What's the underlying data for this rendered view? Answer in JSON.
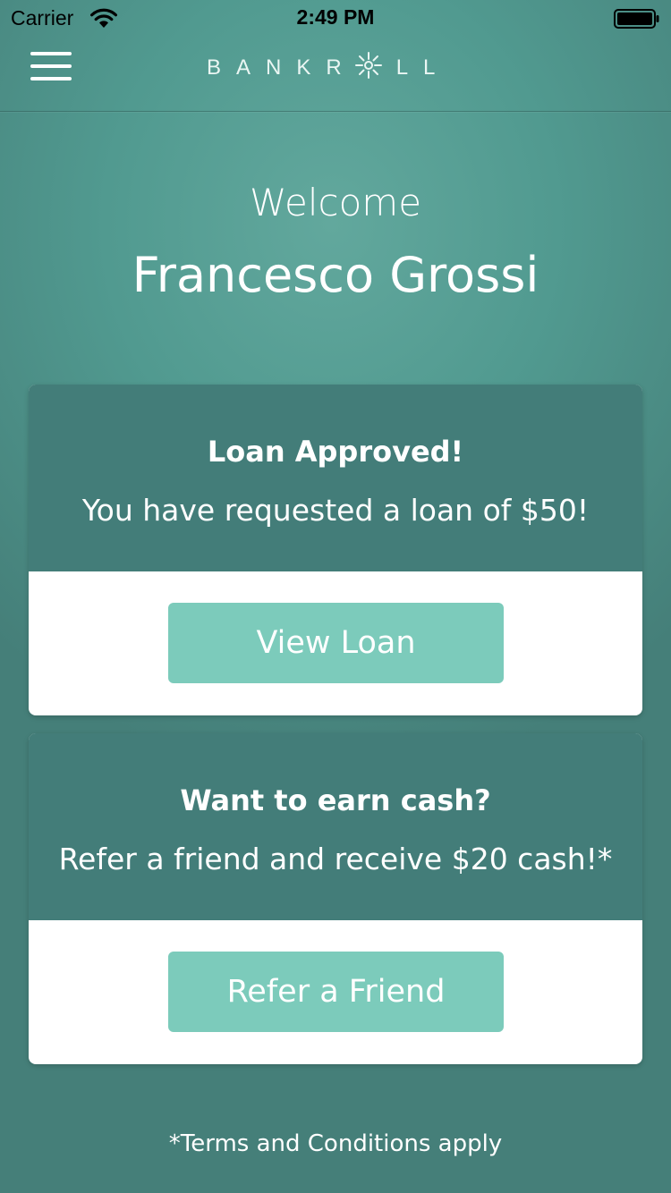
{
  "status_bar": {
    "carrier": "Carrier",
    "time": "2:49 PM"
  },
  "header": {
    "logo_text_left": "BANKR",
    "logo_text_right": "LL",
    "icons": [
      "menu-icon",
      "sun-icon"
    ]
  },
  "welcome": {
    "greeting": "Welcome",
    "name": "Francesco Grossi"
  },
  "cards": [
    {
      "title": "Loan Approved!",
      "text": "You have requested a loan of $50!",
      "button_label": "View Loan"
    },
    {
      "title": "Want to earn cash?",
      "text": "Refer a friend and receive $20 cash!*",
      "button_label": "Refer a Friend"
    }
  ],
  "footer": {
    "terms": "*Terms and Conditions apply"
  },
  "colors": {
    "background": "#519a90",
    "card_header": "#437d79",
    "button": "#7ccbbb",
    "text": "#ffffff"
  }
}
